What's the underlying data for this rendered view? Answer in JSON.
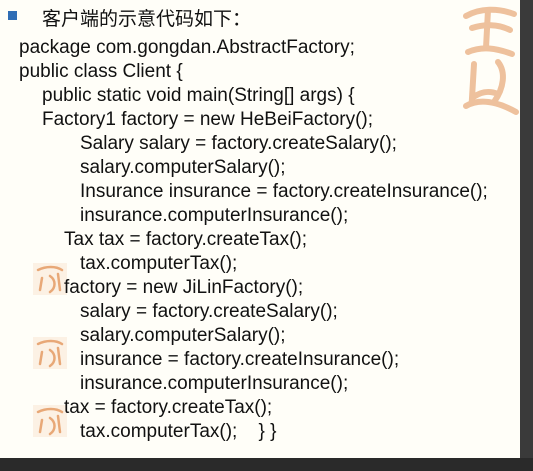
{
  "heading": "客户端的示意代码如下：",
  "code_lines": [
    "package com.gongdan.AbstractFactory;",
    "public class Client {",
    "public static void main(String[] args) {",
    "Factory1 factory = new HeBeiFactory();",
    "Salary salary = factory.createSalary();",
    "salary.computerSalary();",
    "Insurance insurance = factory.createInsurance();",
    "insurance.computerInsurance();",
    "Tax tax = factory.createTax();",
    "tax.computerTax();",
    "factory = new JiLinFactory();",
    "salary = factory.createSalary();",
    "salary.computerSalary();",
    "insurance = factory.createInsurance();",
    "insurance.computerInsurance();",
    "tax = factory.createTax();",
    "tax.computerTax();    } }"
  ],
  "colors": {
    "bullet": "#2f6db5",
    "seal": "#e8a877",
    "slide_background": "#fffef8"
  },
  "icons": {
    "bullet": "square-bullet-icon",
    "seal": "calligraphy-seal-icon"
  }
}
